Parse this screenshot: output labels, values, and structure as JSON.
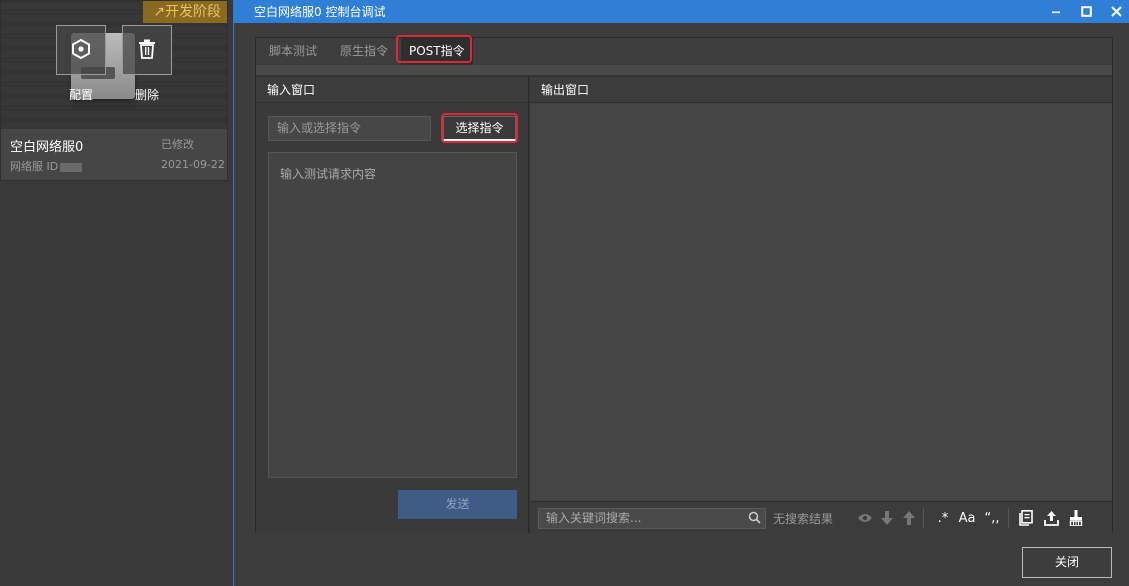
{
  "server_card": {
    "badge": "↗开发阶段",
    "config_label": "配置",
    "delete_label": "删除",
    "name": "空白网络服0",
    "modified": "已修改",
    "id_label": "网络服 ID",
    "date": "2021-09-22"
  },
  "dialog": {
    "title": "空白网络服0 控制台调试",
    "tabs": [
      "脚本测试",
      "原生指令",
      "POST指令"
    ],
    "active_tab": "POST指令",
    "input_pane": {
      "title": "输入窗口",
      "command_placeholder": "输入或选择指令",
      "select_button": "选择指令",
      "request_placeholder": "输入测试请求内容",
      "send_button": "发送"
    },
    "output_pane": {
      "title": "输出窗口",
      "search_placeholder": "输入关键词搜索...",
      "search_status": "无搜索结果",
      "regex_label": ".*",
      "case_label": "Aa",
      "quote_label": "“,,"
    },
    "close_button": "关闭"
  },
  "colors": {
    "accent": "#2f7fd7",
    "highlight": "#e0263a",
    "badge_bg": "#8a6a1e"
  }
}
